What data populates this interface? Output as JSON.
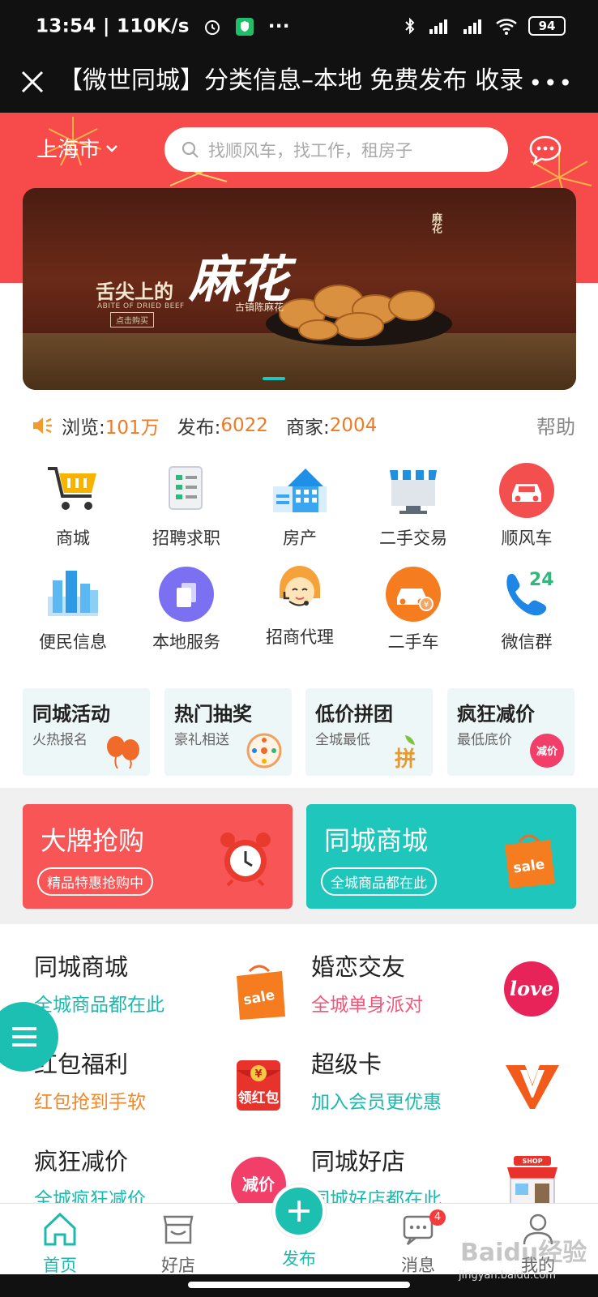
{
  "status_bar": {
    "time": "13:54",
    "speed": "110K/s",
    "battery": "94",
    "more": "···"
  },
  "title_bar": {
    "title": "【微世同城】分类信息–本地 免费发布 收录",
    "more": "•••"
  },
  "header": {
    "city": "上海市",
    "search_placeholder": "找顺风车，找工作，租房子"
  },
  "banner": {
    "headline_small": "舌尖上的",
    "headline_big": "麻花",
    "subtitle": "古镇陈麻花",
    "english": "ABITE OF DRIED BEEF",
    "button": "点击购买",
    "side_text": "麻花"
  },
  "stats": {
    "browse_label": "浏览:",
    "browse_value": "101万",
    "publish_label": "发布:",
    "publish_value": "6022",
    "merchant_label": "商家:",
    "merchant_value": "2004",
    "help": "帮助"
  },
  "icon_grid": [
    {
      "label": "商城",
      "icon": "shopping-cart-icon"
    },
    {
      "label": "招聘求职",
      "icon": "document-list-icon"
    },
    {
      "label": "房产",
      "icon": "house-icon"
    },
    {
      "label": "二手交易",
      "icon": "storefront-icon"
    },
    {
      "label": "顺风车",
      "icon": "car-icon"
    },
    {
      "label": "便民信息",
      "icon": "city-buildings-icon"
    },
    {
      "label": "本地服务",
      "icon": "copy-icon"
    },
    {
      "label": "招商代理",
      "icon": "customer-service-icon"
    },
    {
      "label": "二手车",
      "icon": "used-car-icon"
    },
    {
      "label": "微信群",
      "icon": "phone-24-icon"
    }
  ],
  "promos": [
    {
      "title": "同城活动",
      "subtitle": "火热报名"
    },
    {
      "title": "热门抽奖",
      "subtitle": "豪礼相送"
    },
    {
      "title": "低价拼团",
      "subtitle": "全城最低"
    },
    {
      "title": "疯狂减价",
      "subtitle": "最低底价"
    }
  ],
  "big_cards": [
    {
      "title": "大牌抢购",
      "pill": "精品特惠抢购中",
      "color": "#f75556"
    },
    {
      "title": "同城商城",
      "pill": "全城商品都在此",
      "color": "#1fc6bb"
    }
  ],
  "list": [
    {
      "title": "同城商城",
      "subtitle": "全城商品都在此",
      "color": "#1cb9ad"
    },
    {
      "title": "婚恋交友",
      "subtitle": "全城单身派对",
      "color": "#f0587a"
    },
    {
      "title": "红包福利",
      "subtitle": "红包抢到手软",
      "color": "#f2892b"
    },
    {
      "title": "超级卡",
      "subtitle": "加入会员更优惠",
      "color": "#1cb9ad"
    },
    {
      "title": "疯狂减价",
      "subtitle": "全城疯狂减价",
      "color": "#1cb9ad"
    },
    {
      "title": "同城好店",
      "subtitle": "同城好店都在此",
      "color": "#1cb9ad"
    }
  ],
  "list_images": {
    "sale_text": "sale",
    "hongbao_text": "领红包",
    "love_text": "love",
    "jianjia_text": "减价",
    "shop_text": "SHOP"
  },
  "tabs": [
    {
      "label": "首页"
    },
    {
      "label": "好店"
    },
    {
      "label": "发布"
    },
    {
      "label": "消息"
    },
    {
      "label": "我的"
    }
  ],
  "message_badge": "4",
  "watermark": {
    "text": "Baidu经验",
    "url": "jingyan.baidu.com"
  },
  "colors": {
    "accent": "#1cb9ad",
    "header_red": "#f64a4b",
    "orange": "#f07a24"
  }
}
